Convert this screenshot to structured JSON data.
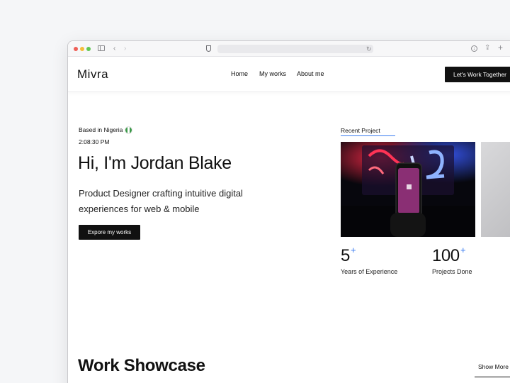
{
  "browser": {
    "icons": {
      "sidebar": "sidebar-toggle-icon",
      "back": "chevron-left-icon",
      "forward": "chevron-right-icon",
      "privacy": "shield-icon",
      "reload": "reload-icon",
      "download": "download-icon",
      "share": "share-icon",
      "new_tab": "plus-icon"
    },
    "back_glyph": "‹",
    "forward_glyph": "›",
    "reload_glyph": "↻",
    "download_glyph": "↓",
    "share_glyph": "⇪",
    "plus_glyph": "+"
  },
  "header": {
    "logo": "Mivra",
    "nav": [
      "Home",
      "My works",
      "About me"
    ],
    "cta": "Let's Work Together"
  },
  "intro": {
    "location": "Based in Nigeria",
    "time": "2:08:30 PM",
    "headline": "Hi, I'm Jordan Blake",
    "subheadline": "Product Designer crafting intuitive digital experiences for web & mobile",
    "explore_button": "Expore my works"
  },
  "recent": {
    "label": "Recent Project"
  },
  "stats": [
    {
      "value": "5",
      "suffix": "+",
      "label": "Years of Experience"
    },
    {
      "value": "100",
      "suffix": "+",
      "label": "Projects Done"
    }
  ],
  "showcase": {
    "title": "Work Showcase",
    "show_more": "Show More"
  },
  "colors": {
    "accent": "#3b7cf0",
    "dark": "#111111",
    "flag_green": "#3c9a4a"
  }
}
